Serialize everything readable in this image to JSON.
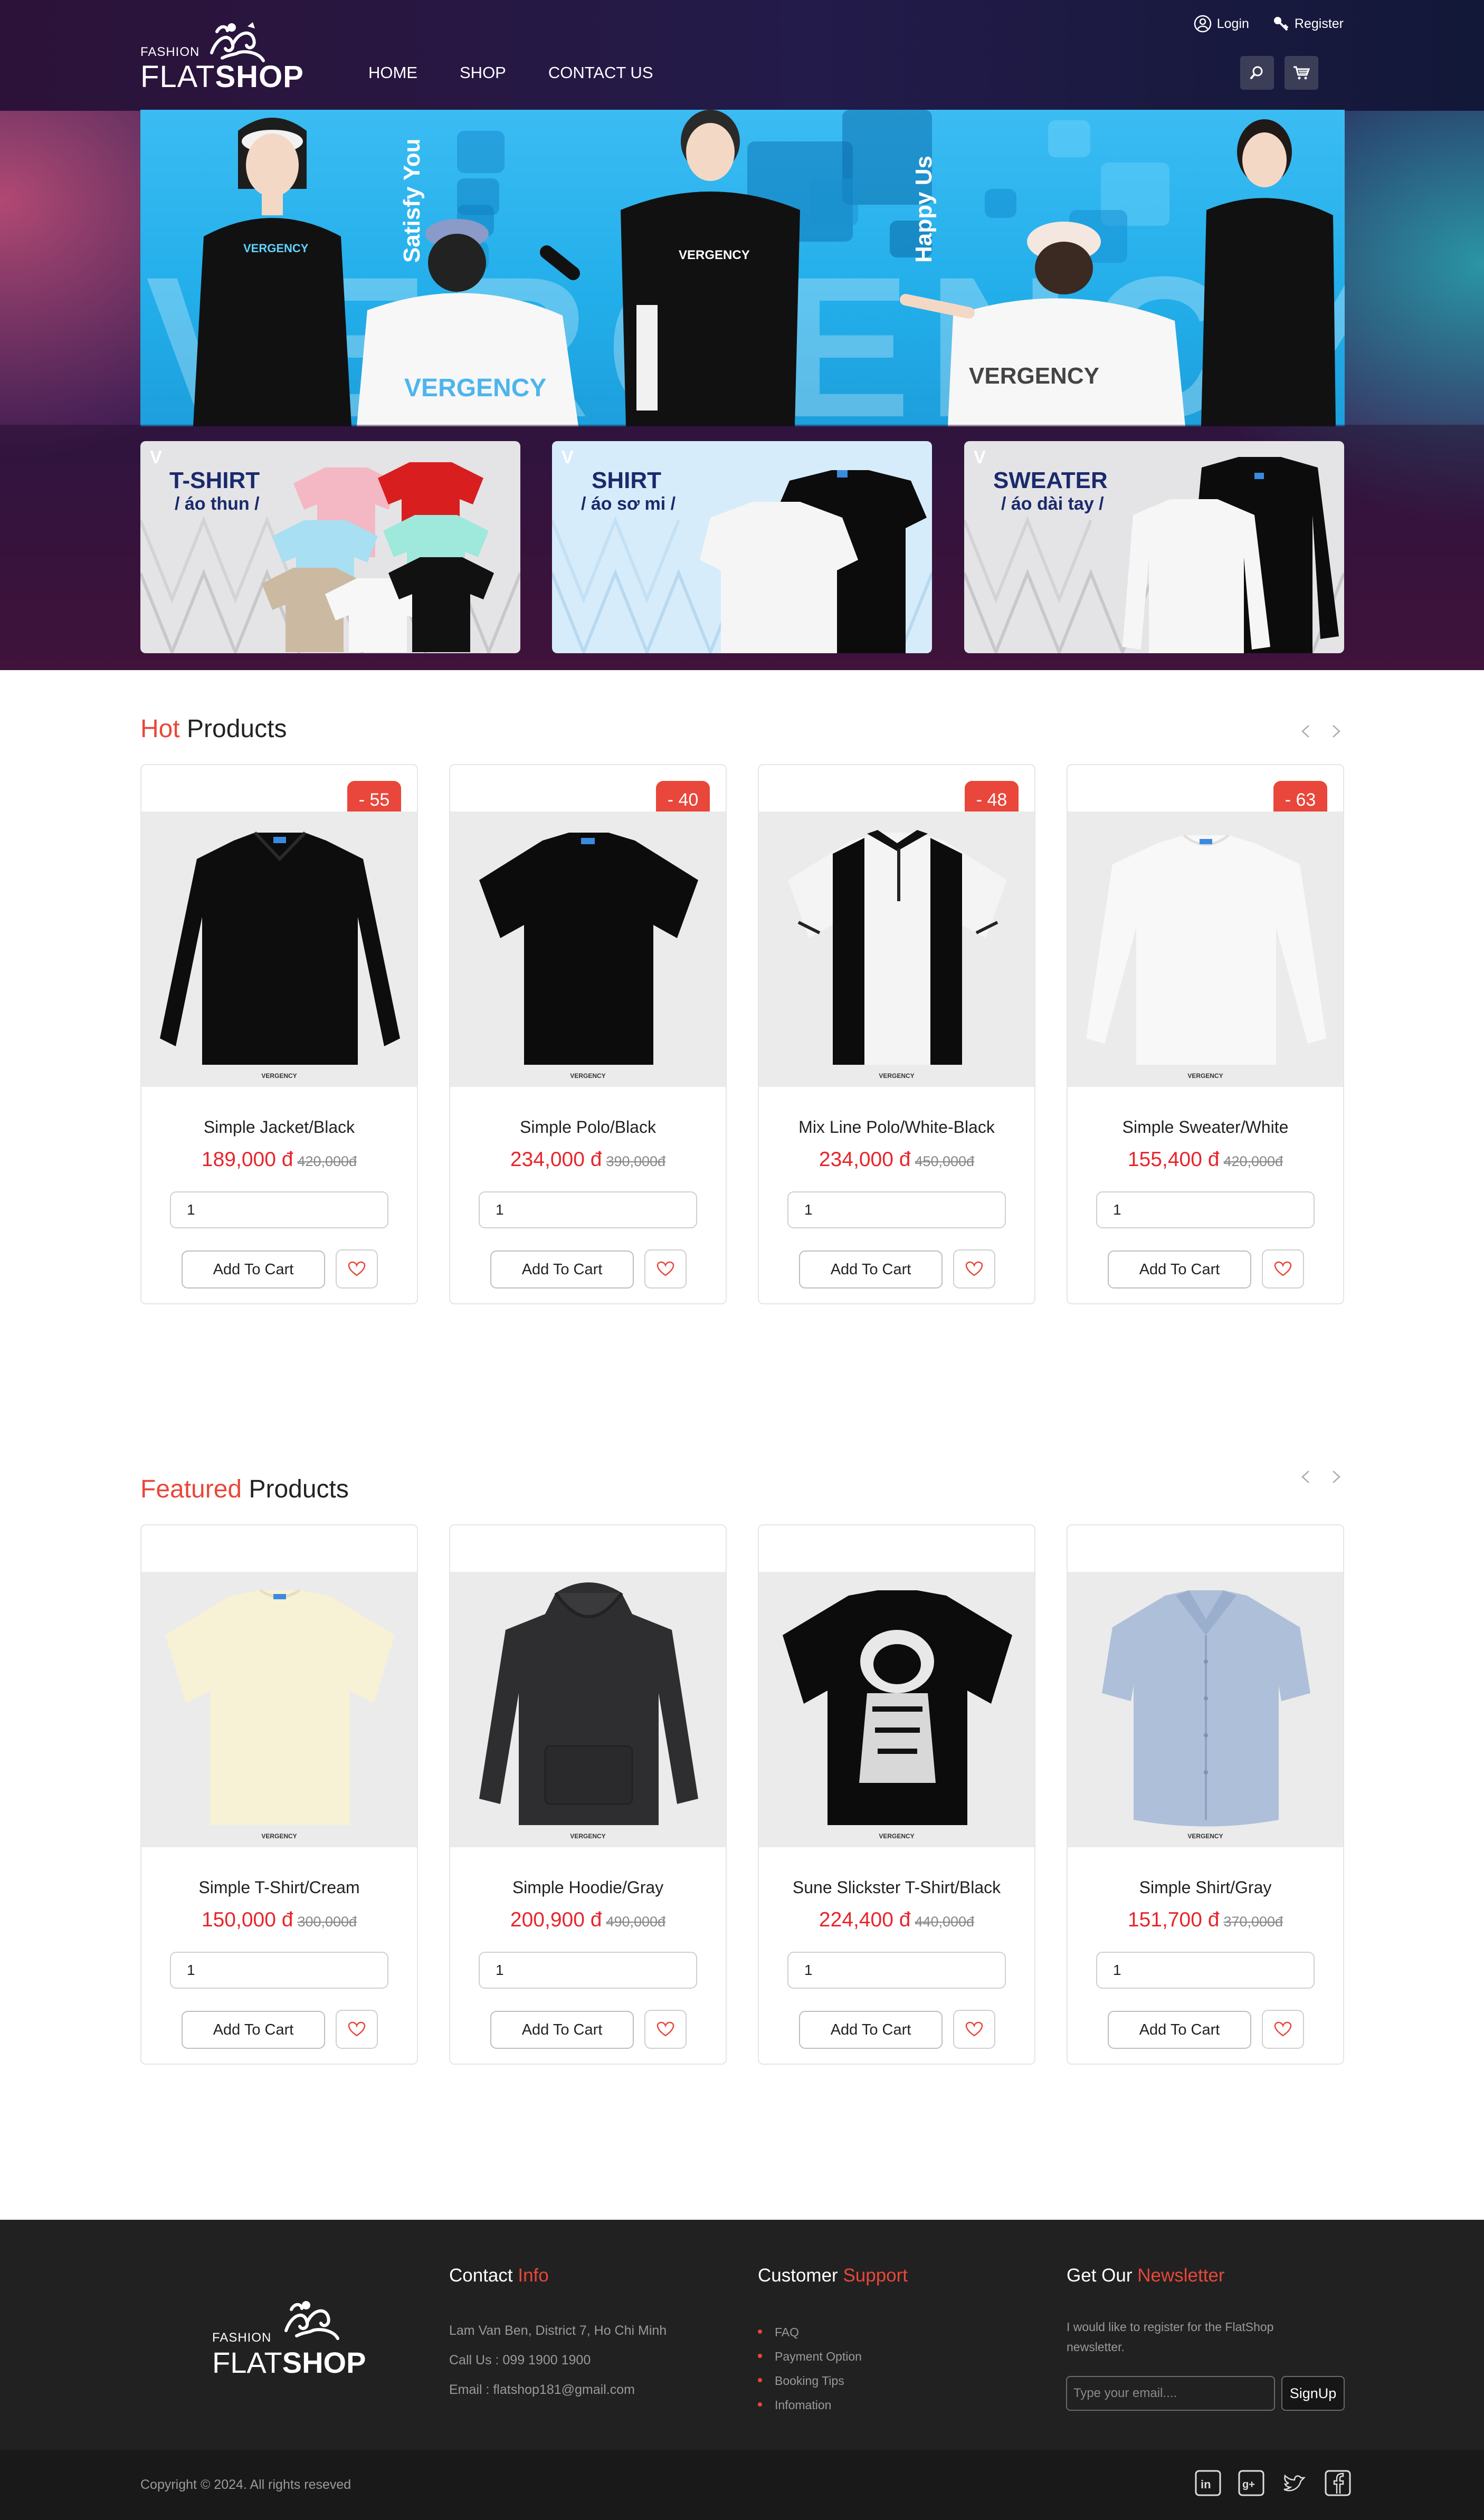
{
  "brand": {
    "small": "FASHION",
    "flat": "FLAT",
    "shop": "SHOP"
  },
  "nav": {
    "home": "HOME",
    "shop": "SHOP",
    "contact": "CONTACT US"
  },
  "auth": {
    "login": "Login",
    "register": "Register"
  },
  "icons": {
    "search": "search-icon",
    "cart": "cart-icon",
    "user": "user-icon",
    "key": "key-icon",
    "heart": "heart-icon"
  },
  "banner": {
    "big_word": "VERGENCY",
    "vertical_left": "Satisfy You",
    "vertical_right": "Happy Us",
    "shirt_prints": [
      "VERGENCY",
      "VERGENCY",
      "VERGENCY",
      "VERGENCY"
    ]
  },
  "categories": [
    {
      "mark": "V",
      "title": "T-SHIRT",
      "subtitle": "/ áo thun /"
    },
    {
      "mark": "V",
      "title": "SHIRT",
      "subtitle": "/ áo sơ mi /"
    },
    {
      "mark": "V",
      "title": "SWEATER",
      "subtitle": "/ áo dài tay /"
    }
  ],
  "hot": {
    "accent": "Hot",
    "rest": " Products",
    "products": [
      {
        "discount": "- 55",
        "name": "Simple Jacket/Black",
        "price": "189,000 đ",
        "old_price": "420,000đ",
        "qty": "1",
        "brand": "VERGENCY"
      },
      {
        "discount": "- 40",
        "name": "Simple Polo/Black",
        "price": "234,000 đ",
        "old_price": "390,000đ",
        "qty": "1",
        "brand": "VERGENCY"
      },
      {
        "discount": "- 48",
        "name": "Mix Line Polo/White-Black",
        "price": "234,000 đ",
        "old_price": "450,000đ",
        "qty": "1",
        "brand": "VERGENCY"
      },
      {
        "discount": "- 63",
        "name": "Simple Sweater/White",
        "price": "155,400 đ",
        "old_price": "420,000đ",
        "qty": "1",
        "brand": "VERGENCY"
      }
    ]
  },
  "featured": {
    "accent": "Featured",
    "rest": " Products",
    "products": [
      {
        "name": "Simple T-Shirt/Cream",
        "price": "150,000 đ",
        "old_price": "300,000đ",
        "qty": "1",
        "brand": "VERGENCY"
      },
      {
        "name": "Simple Hoodie/Gray",
        "price": "200,900 đ",
        "old_price": "490,000đ",
        "qty": "1",
        "brand": "VERGENCY"
      },
      {
        "name": "Sune Slickster T-Shirt/Black",
        "price": "224,400 đ",
        "old_price": "440,000đ",
        "qty": "1",
        "brand": "VERGENCY"
      },
      {
        "name": "Simple Shirt/Gray",
        "price": "151,700 đ",
        "old_price": "370,000đ",
        "qty": "1",
        "brand": "VERGENCY"
      }
    ]
  },
  "buttons": {
    "add_to_cart": "Add To Cart"
  },
  "footer": {
    "contact_title": "Contact ",
    "contact_accent": "Info",
    "address": "Lam Van Ben, District 7, Ho Chi Minh",
    "phone": "Call Us : 099 1900 1900",
    "email": "Email : flatshop181@gmail.com",
    "support_title": "Customer ",
    "support_accent": "Support",
    "support_links": [
      "FAQ",
      "Payment Option",
      "Booking Tips",
      "Infomation"
    ],
    "newsletter_title": "Get Our ",
    "newsletter_accent": "Newsletter",
    "newsletter_text_1": "I would like to register for the FlatShop",
    "newsletter_text_2": "newsletter.",
    "newsletter_placeholder": "Type your email....",
    "signup": "SignUp",
    "copyright": "Copyright © 2024. All rights reseved",
    "socials": [
      "linkedin-icon",
      "google-plus-icon",
      "twitter-icon",
      "facebook-icon"
    ]
  },
  "colors": {
    "accent": "#e8473a",
    "price": "#e8242b",
    "banner_blue": "#22aeea",
    "footer_bg": "#212121"
  }
}
